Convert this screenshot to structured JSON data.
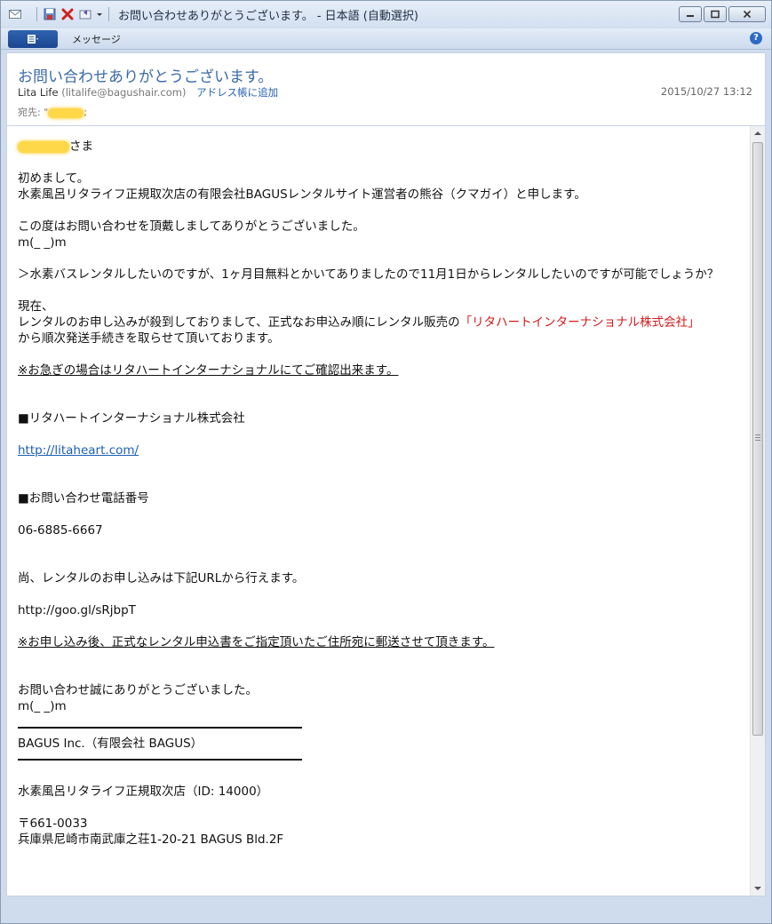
{
  "window": {
    "title": "お問い合わせありがとうございます。 - 日本語 (自動選択)"
  },
  "ribbon": {
    "tab_message": "メッセージ",
    "help": "?"
  },
  "header": {
    "subject": "お問い合わせありがとうございます。",
    "from_name": "Lita Life",
    "from_addr": "(litalife@bagushair.com)",
    "add_to_contacts": "アドレス帳に追加",
    "date": "2015/10/27 13:12",
    "to_label": "宛先: \"",
    "to_suffix": ";"
  },
  "body": {
    "salutation_suffix": "さま",
    "p1": "初めまして。",
    "p2": "水素風呂リタライフ正規取次店の有限会社BAGUSレンタルサイト運営者の熊谷（クマガイ）と申します。",
    "p3": "この度はお問い合わせを頂戴しましてありがとうございました。",
    "emote1": "m(_ _)m",
    "quote": "＞水素バスレンタルしたいのですが、1ヶ月目無料とかいてありましたので11月1日からレンタルしたいのですが可能でしょうか？",
    "p4": "現在、",
    "p5_a": "レンタルのお申し込みが殺到しておりまして、正式なお申込み順にレンタル販売の",
    "p5_red": "「リタハートインターナショナル株式会社」",
    "p6": "から順次発送手続きを取らせて頂いております。",
    "note1": "※お急ぎの場合はリタハートインターナショナルにてご確認出来ます。",
    "sec1": "■リタハートインターナショナル株式会社",
    "link1": "http://litaheart.com/",
    "sec2": "■お問い合わせ電話番号",
    "phone": "06-6885-6667",
    "p7": "尚、レンタルのお申し込みは下記URLから行えます。",
    "url2": "http://goo.gl/sRjbpT",
    "note2": "※お申し込み後、正式なレンタル申込書をご指定頂いたご住所宛に郵送させて頂きます。",
    "p8": "お問い合わせ誠にありがとうございました。",
    "emote2": "m(_ _)m",
    "company": "BAGUS Inc.（有限会社 BAGUS）",
    "shop": "水素風呂リタライフ正規取次店（ID: 14000）",
    "zip": "〒661-0033",
    "address": "兵庫県尼崎市南武庫之荘1-20-21 BAGUS Bld.2F"
  },
  "colors": {
    "accent": "#3a6aa8",
    "link": "#1a5fb4",
    "red": "#d21a1a"
  }
}
